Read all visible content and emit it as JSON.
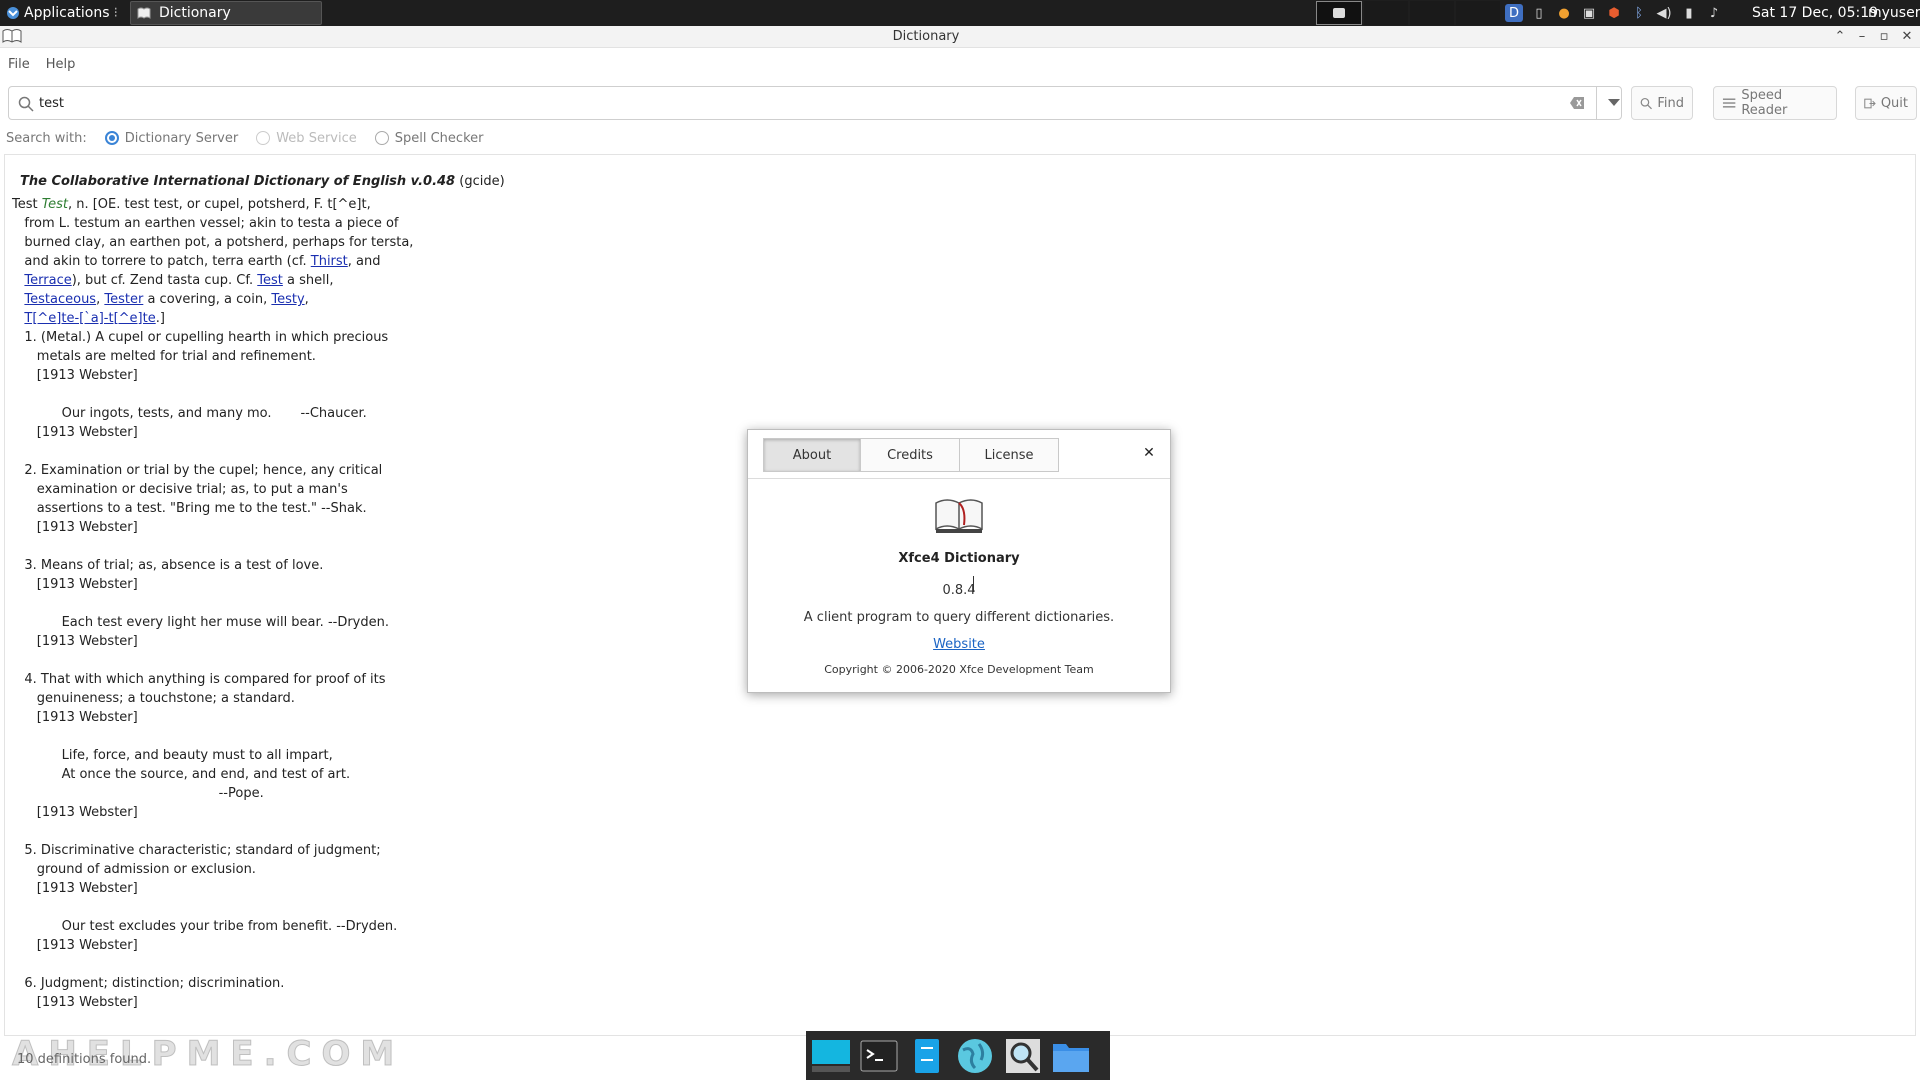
{
  "panel": {
    "applications_label": "Applications",
    "task_label": "Dictionary",
    "clock": "Sat 17 Dec, 05:19",
    "user": "myuser"
  },
  "window": {
    "title": "Dictionary",
    "menu": {
      "file": "File",
      "help": "Help"
    }
  },
  "search": {
    "value": "test",
    "find_label": "Find",
    "speed_reader_label": "Speed Reader",
    "quit_label": "Quit",
    "search_with_label": "Search with:",
    "options": {
      "dictionary_server": "Dictionary Server",
      "web_service": "Web Service",
      "spell_checker": "Spell Checker"
    },
    "selected": "Dictionary Server"
  },
  "result": {
    "dictionary_title": "The Collaborative International Dictionary of English v.0.48",
    "dictionary_code": "(gcide)",
    "headword": "Test",
    "headword_italic": "Test",
    "lines": {
      "l1_rest": ", n. [OE. test test, or cupel, potsherd, F. t[^e]t,",
      "l2": "   from L. testum an earthen vessel; akin to testa a piece of",
      "l3": "   burned clay, an earthen pot, a potsherd, perhaps for tersta,",
      "l4a": "   and akin to torrere to patch, terra earth (cf. ",
      "l4_link": "Thirst",
      "l4b": ", and",
      "l5_link": "Terrace",
      "l5a": "), but cf. Zend tasta cup. Cf. ",
      "l5_link2": "Test",
      "l5b": " a shell,",
      "l6_link1": "Testaceous",
      "l6_link2": "Tester",
      "l6a": " a covering, a coin, ",
      "l6_link3": "Testy",
      "l7_link": "T[^e]te-[`a]-t[^e]te",
      "body": "   1. (Metal.) A cupel or cupelling hearth in which precious\n      metals are melted for trial and refinement.\n      [1913 Webster]\n\n            Our ingots, tests, and many mo.       --Chaucer.\n      [1913 Webster]\n\n   2. Examination or trial by the cupel; hence, any critical\n      examination or decisive trial; as, to put a man's\n      assertions to a test. \"Bring me to the test.\" --Shak.\n      [1913 Webster]\n\n   3. Means of trial; as, absence is a test of love.\n      [1913 Webster]\n\n            Each test every light her muse will bear. --Dryden.\n      [1913 Webster]\n\n   4. That with which anything is compared for proof of its\n      genuineness; a touchstone; a standard.\n      [1913 Webster]\n\n            Life, force, and beauty must to all impart,\n            At once the source, and end, and test of art.\n                                                  --Pope.\n      [1913 Webster]\n\n   5. Discriminative characteristic; standard of judgment;\n      ground of admission or exclusion.\n      [1913 Webster]\n\n            Our test excludes your tribe from benefit. --Dryden.\n      [1913 Webster]\n\n   6. Judgment; distinction; discrimination.\n      [1913 Webster]"
    }
  },
  "status": "10 definitions found.",
  "watermark": "AHELPME.COM",
  "about_dialog": {
    "tabs": [
      "About",
      "Credits",
      "License"
    ],
    "active_tab": "About",
    "app_name": "Xfce4 Dictionary",
    "version": "0.8.4",
    "description": "A client program to query different dictionaries.",
    "website_label": "Website",
    "copyright": "Copyright © 2006-2020 Xfce Development Team"
  },
  "colors": {
    "panel_bg": "#1e1e1e",
    "accent": "#3a84d6",
    "link": "#1a2fb0",
    "headword": "#2e7d32"
  }
}
